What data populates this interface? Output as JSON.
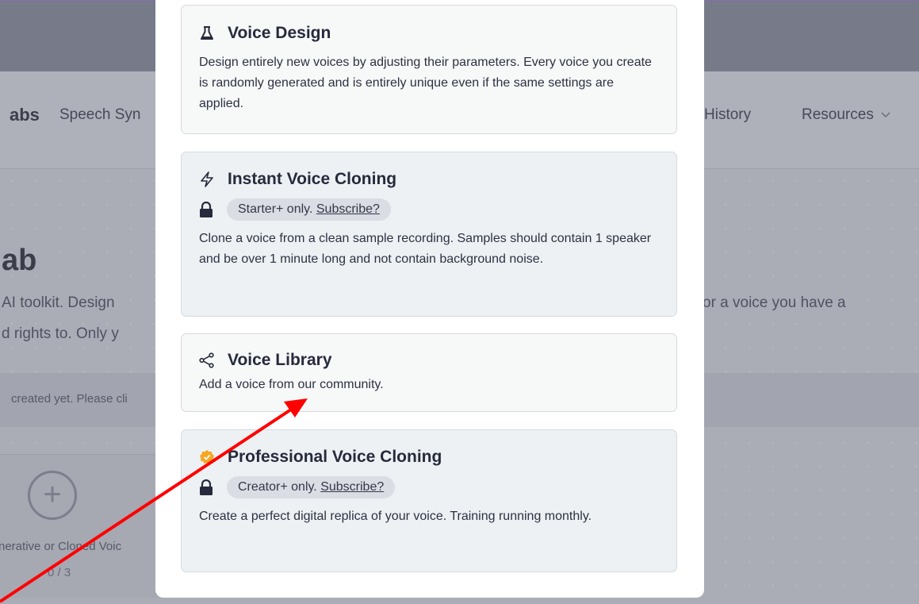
{
  "background": {
    "brand": "abs",
    "nav": {
      "speech": "Speech Syn",
      "history": "History",
      "resources": "Resources"
    },
    "heading": "ab",
    "desc_line1_left": "AI toolkit. Design",
    "desc_line1_right": "or a voice you have a",
    "desc_line2_left": "d rights to. Only y",
    "notice": "created yet. Please cli",
    "add_card": {
      "label": "nerative or Cloned Voic",
      "count": "0 / 3"
    }
  },
  "modal": {
    "options": [
      {
        "title": "Voice Design",
        "icon": "flask-icon",
        "description": "Design entirely new voices by adjusting their parameters. Every voice you create is randomly generated and is entirely unique even if the same settings are applied."
      },
      {
        "title": "Instant Voice Cloning",
        "icon": "lightning-icon",
        "badge": {
          "text": "Starter+ only.",
          "link": "Subscribe?"
        },
        "description": "Clone a voice from a clean sample recording. Samples should contain 1 speaker and be over 1 minute long and not contain background noise."
      },
      {
        "title": "Voice Library",
        "icon": "share-icon",
        "description": "Add a voice from our community."
      },
      {
        "title": "Professional Voice Cloning",
        "icon": "verified-badge-icon",
        "badge": {
          "text": "Creator+ only.",
          "link": "Subscribe?"
        },
        "description": "Create a perfect digital replica of your voice. Training running monthly."
      }
    ]
  },
  "colors": {
    "annotation_arrow": "#ff0000",
    "verified_badge": "#f5a623"
  }
}
